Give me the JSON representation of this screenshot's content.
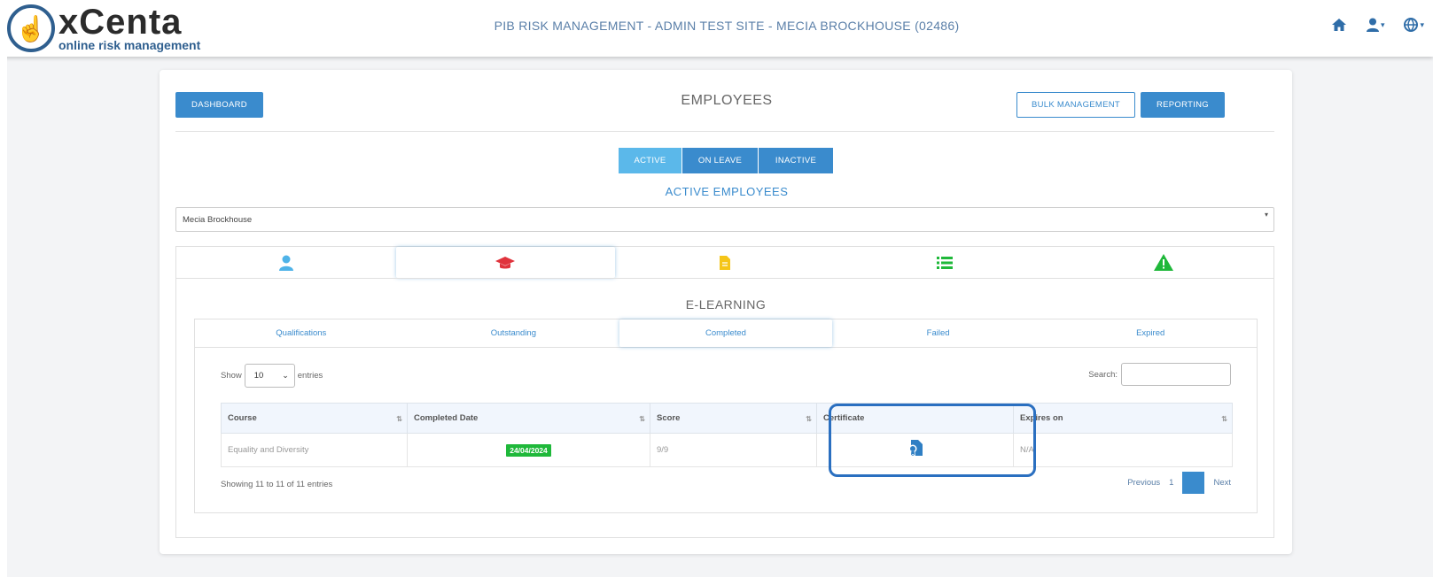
{
  "header": {
    "logo_name": "xCenta",
    "logo_tagline": "online risk management",
    "site_title": "PIB RISK MANAGEMENT - ADMIN TEST SITE - MECIA BROCKHOUSE (02486)",
    "icons": [
      "home-icon",
      "user-icon",
      "globe-icon"
    ]
  },
  "toolbar": {
    "dashboard_label": "DASHBOARD",
    "page_title": "EMPLOYEES",
    "bulk_label": "BULK MANAGEMENT",
    "reporting_label": "REPORTING"
  },
  "status_tabs": {
    "active": "ACTIVE",
    "on_leave": "ON LEAVE",
    "inactive": "INACTIVE",
    "selected": "ACTIVE"
  },
  "subheading": "ACTIVE EMPLOYEES",
  "employee_select": {
    "value": "Mecia Brockhouse"
  },
  "icon_tabs": [
    {
      "name": "user-icon",
      "color": "#4fb3e8"
    },
    {
      "name": "graduation-cap-icon",
      "color": "#e0333c"
    },
    {
      "name": "document-icon",
      "color": "#f5c518"
    },
    {
      "name": "list-icon",
      "color": "#1fb83a"
    },
    {
      "name": "warning-icon",
      "color": "#1fb83a"
    }
  ],
  "panel_title": "E-LEARNING",
  "sub_tabs": [
    "Qualifications",
    "Outstanding",
    "Completed",
    "Failed",
    "Expired"
  ],
  "active_sub_tab": "Completed",
  "table": {
    "show_label": "Show",
    "entries_label": "entries",
    "page_length": "10",
    "search_label": "Search:",
    "columns": [
      "Course",
      "Completed Date",
      "Score",
      "Certificate",
      "Expires on"
    ],
    "rows": [
      {
        "course": "Equality and Diversity",
        "completed_date": "24/04/2024",
        "score": "9/9",
        "certificate_icon": "certificate-icon",
        "expires_on": "N/A"
      }
    ],
    "info": "Showing 11 to 11 of 11 entries",
    "pager": {
      "previous": "Previous",
      "page": "1",
      "next": "Next"
    }
  },
  "colors": {
    "accent": "#3a8bcd",
    "active_segment": "#5bb8ea",
    "badge_green": "#1fb83a",
    "highlight": "#2a6fc0"
  }
}
